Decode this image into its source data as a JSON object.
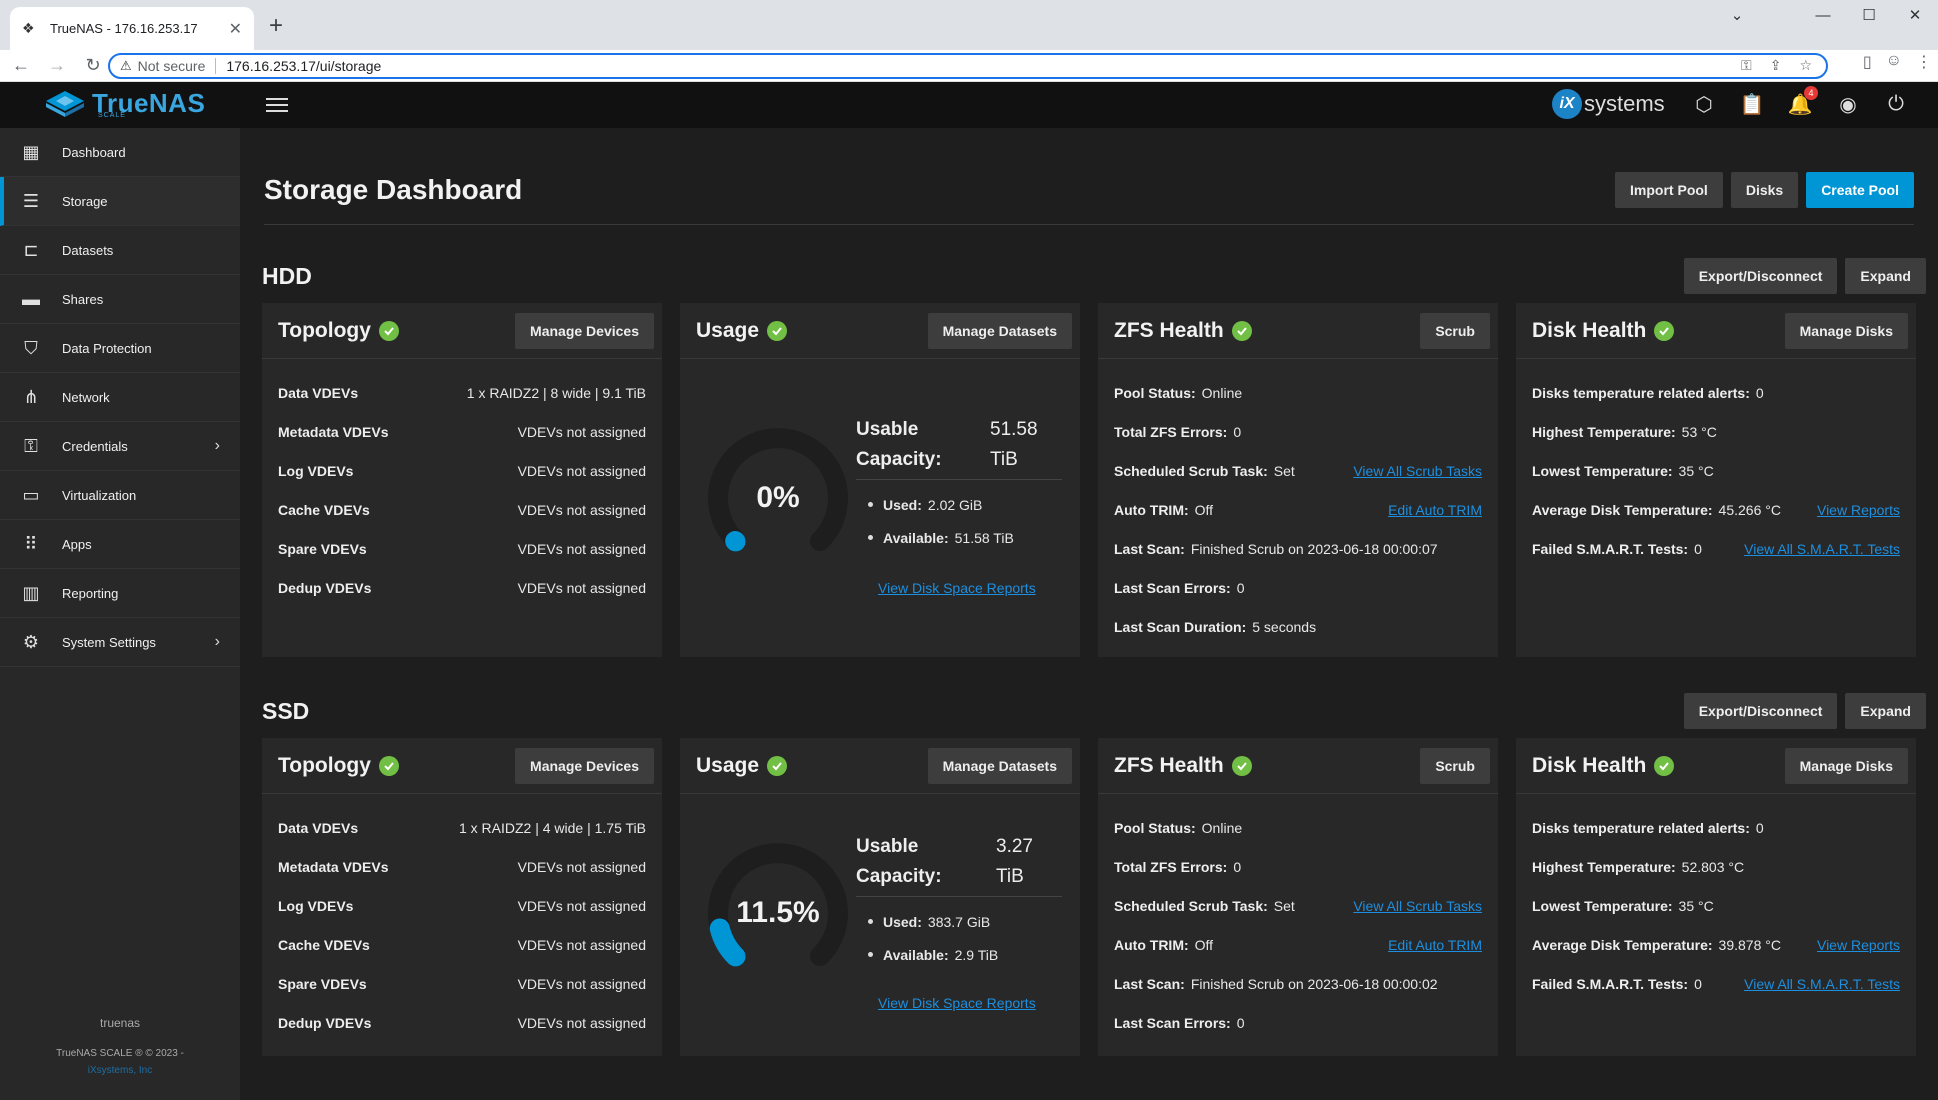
{
  "browser": {
    "tab_title": "TrueNAS - 176.16.253.17",
    "not_secure": "Not secure",
    "url": "176.16.253.17/ui/storage"
  },
  "app": {
    "logo": "TrueNAS",
    "logo_sub": "SCALE",
    "vendor": "systems",
    "notification_count": "4"
  },
  "sidebar": {
    "items": [
      {
        "label": "Dashboard",
        "icon": "dashboard-icon"
      },
      {
        "label": "Storage",
        "icon": "storage-icon"
      },
      {
        "label": "Datasets",
        "icon": "datasets-icon"
      },
      {
        "label": "Shares",
        "icon": "shares-icon"
      },
      {
        "label": "Data Protection",
        "icon": "shield-icon"
      },
      {
        "label": "Network",
        "icon": "network-icon"
      },
      {
        "label": "Credentials",
        "icon": "key-icon"
      },
      {
        "label": "Virtualization",
        "icon": "laptop-icon"
      },
      {
        "label": "Apps",
        "icon": "apps-grid-icon"
      },
      {
        "label": "Reporting",
        "icon": "reporting-icon"
      },
      {
        "label": "System Settings",
        "icon": "gear-icon"
      }
    ],
    "hostname": "truenas",
    "copyright": "TrueNAS SCALE ® © 2023 -",
    "company": "iXsystems, Inc"
  },
  "header": {
    "title": "Storage Dashboard",
    "import_pool": "Import Pool",
    "disks": "Disks",
    "create_pool": "Create Pool"
  },
  "common": {
    "export_disconnect": "Export/Disconnect",
    "expand": "Expand",
    "topology": "Topology",
    "manage_devices": "Manage Devices",
    "usage": "Usage",
    "manage_datasets": "Manage Datasets",
    "zfs_health": "ZFS Health",
    "scrub": "Scrub",
    "disk_health": "Disk Health",
    "manage_disks": "Manage Disks",
    "usable_capacity": "Usable Capacity:",
    "used_label": "Used:",
    "available_label": "Available:",
    "view_disk_space_reports": "View Disk Space Reports",
    "view_all_scrub_tasks": "View All Scrub Tasks",
    "edit_auto_trim": "Edit Auto TRIM",
    "view_reports": "View Reports",
    "view_all_smart_tests": "View All S.M.A.R.T. Tests"
  },
  "pools": [
    {
      "name": "HDD",
      "topology": [
        {
          "k": "Data VDEVs",
          "v": "1 x RAIDZ2 | 8 wide | 9.1 TiB"
        },
        {
          "k": "Metadata VDEVs",
          "v": "VDEVs not assigned"
        },
        {
          "k": "Log VDEVs",
          "v": "VDEVs not assigned"
        },
        {
          "k": "Cache VDEVs",
          "v": "VDEVs not assigned"
        },
        {
          "k": "Spare VDEVs",
          "v": "VDEVs not assigned"
        },
        {
          "k": "Dedup VDEVs",
          "v": "VDEVs not assigned"
        }
      ],
      "usage": {
        "percent_label": "0%",
        "percent": 0,
        "capacity_num": "51.58",
        "capacity_unit": "TiB",
        "used": "2.02 GiB",
        "available": "51.58 TiB"
      },
      "zfs": {
        "pool_status_k": "Pool Status:",
        "pool_status": "Online",
        "errors_k": "Total ZFS Errors:",
        "errors": "0",
        "scrub_task_k": "Scheduled Scrub Task:",
        "scrub_task": "Set",
        "trim_k": "Auto TRIM:",
        "trim": "Off",
        "last_scan_k": "Last Scan:",
        "last_scan": "Finished Scrub on 2023-06-18 00:00:07",
        "last_scan_errors_k": "Last Scan Errors:",
        "last_scan_errors": "0",
        "last_scan_duration_k": "Last Scan Duration:",
        "last_scan_duration": "5 seconds"
      },
      "disk": {
        "temp_alerts_k": "Disks temperature related alerts:",
        "temp_alerts": "0",
        "highest_k": "Highest Temperature:",
        "highest": "53 °C",
        "lowest_k": "Lowest Temperature:",
        "lowest": "35 °C",
        "avg_k": "Average Disk Temperature:",
        "avg": "45.266 °C",
        "smart_k": "Failed S.M.A.R.T. Tests:",
        "smart": "0"
      }
    },
    {
      "name": "SSD",
      "topology": [
        {
          "k": "Data VDEVs",
          "v": "1 x RAIDZ2 | 4 wide | 1.75 TiB"
        },
        {
          "k": "Metadata VDEVs",
          "v": "VDEVs not assigned"
        },
        {
          "k": "Log VDEVs",
          "v": "VDEVs not assigned"
        },
        {
          "k": "Cache VDEVs",
          "v": "VDEVs not assigned"
        },
        {
          "k": "Spare VDEVs",
          "v": "VDEVs not assigned"
        },
        {
          "k": "Dedup VDEVs",
          "v": "VDEVs not assigned"
        }
      ],
      "usage": {
        "percent_label": "11.5%",
        "percent": 11.5,
        "capacity_num": "3.27",
        "capacity_unit": "TiB",
        "used": "383.7 GiB",
        "available": "2.9 TiB"
      },
      "zfs": {
        "pool_status_k": "Pool Status:",
        "pool_status": "Online",
        "errors_k": "Total ZFS Errors:",
        "errors": "0",
        "scrub_task_k": "Scheduled Scrub Task:",
        "scrub_task": "Set",
        "trim_k": "Auto TRIM:",
        "trim": "Off",
        "last_scan_k": "Last Scan:",
        "last_scan": "Finished Scrub on 2023-06-18 00:00:02",
        "last_scan_errors_k": "Last Scan Errors:",
        "last_scan_errors": "0"
      },
      "disk": {
        "temp_alerts_k": "Disks temperature related alerts:",
        "temp_alerts": "0",
        "highest_k": "Highest Temperature:",
        "highest": "52.803 °C",
        "lowest_k": "Lowest Temperature:",
        "lowest": "35 °C",
        "avg_k": "Average Disk Temperature:",
        "avg": "39.878 °C",
        "smart_k": "Failed S.M.A.R.T. Tests:",
        "smart": "0"
      }
    }
  ]
}
